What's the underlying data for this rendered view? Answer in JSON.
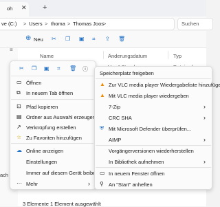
{
  "titlebar": {
    "tab_label": "oh",
    "close_glyph": "✕",
    "add_glyph": "+"
  },
  "address": {
    "crumbs": [
      "ve (C:)",
      "Users",
      "thoma",
      "Thomas Joos"
    ],
    "separator": ">"
  },
  "search": {
    "placeholder": "Suchen"
  },
  "toolbar": {
    "new_label": "Neu"
  },
  "columns": {
    "name": "Name",
    "date": "Änderungsdatum",
    "type": "Typ"
  },
  "row": {
    "date": "Vor 4 Stunden",
    "type": "Dateiordner"
  },
  "nav": {
    "item": "ach G"
  },
  "status": {
    "text": "3 Elemente   1 Element ausgewählt"
  },
  "menu": {
    "items": [
      "Öffnen",
      "In neuem Tab öffnen",
      "Pfad kopieren",
      "Ordner aus Auswahl erzeugen",
      "Verknüpfung erstellen",
      "Zu Favoriten hinzufügen",
      "Online anzeigen",
      "Einstellungen",
      "Immer auf diesem Gerät beibe...",
      "Mehr"
    ],
    "more_arrow": "›"
  },
  "submenu": {
    "items": [
      "Speicherplatz freigeben",
      "Zur VLC media player Wiedergabeliste hinzufügen",
      "Mit VLC media player wiedergeben",
      "7-Zip",
      "CRC SHA",
      "Mit Microsoft Defender überprüfen...",
      "AIMP",
      "Vorgängerversionen wiederherstellen",
      "In Bibliothek aufnehmen",
      "In neuem Fenster öffnen",
      "An \"Start\" anheften"
    ],
    "arrow": "›"
  },
  "colors": {
    "accent": "#1f6fc5",
    "vlc": "#f08a00",
    "menu_bg": "#fbfbfb"
  }
}
